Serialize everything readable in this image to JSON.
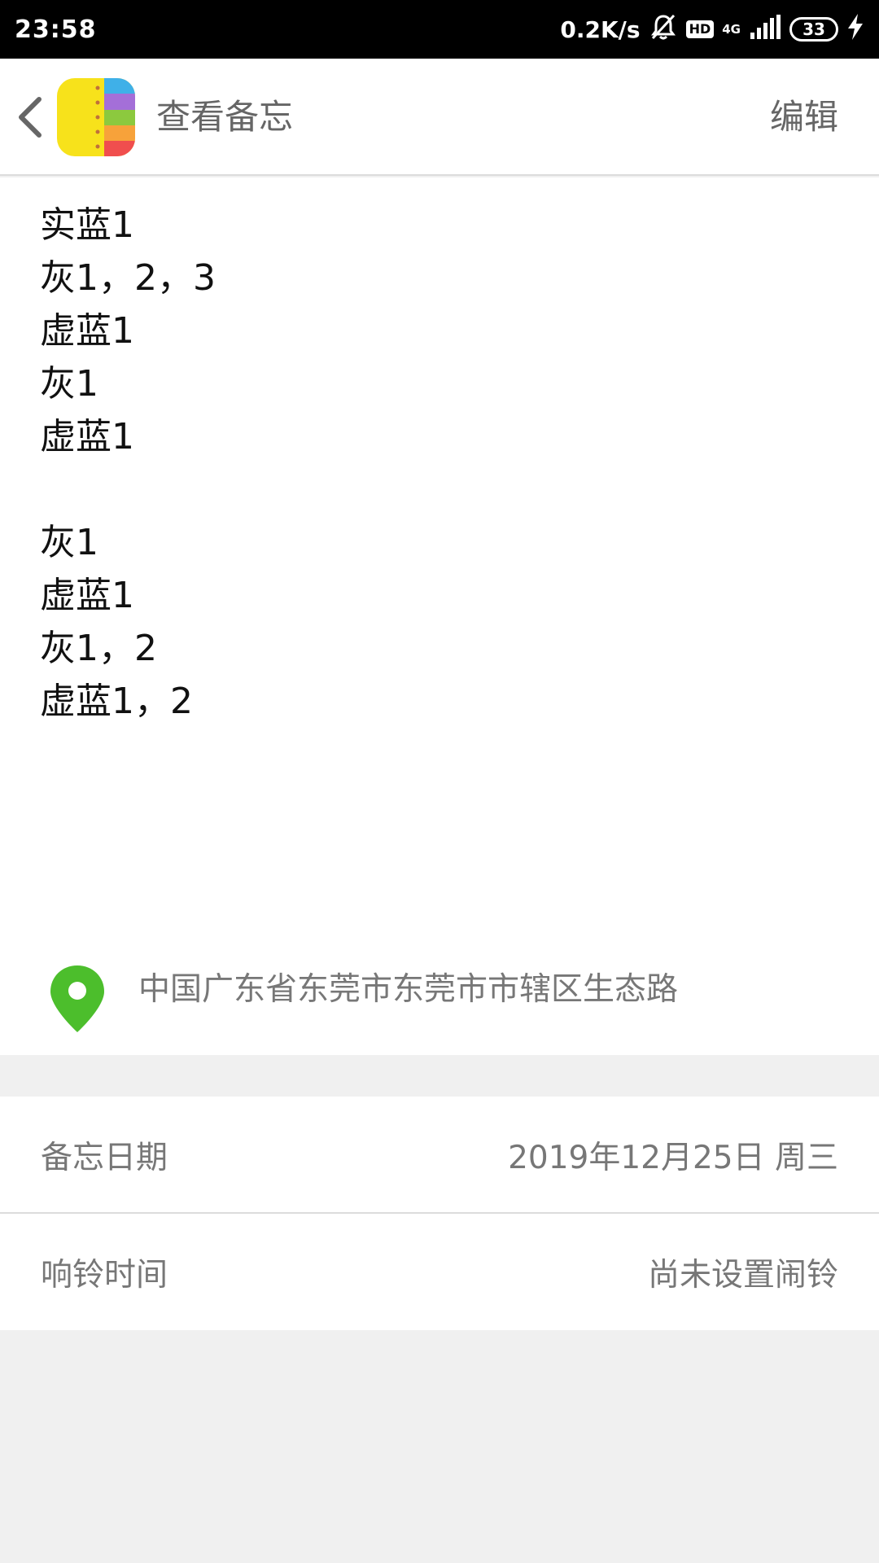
{
  "status_bar": {
    "time": "23:58",
    "net_speed": "0.2K/s",
    "hd_badge": "HD",
    "network": "4G",
    "battery": "33"
  },
  "header": {
    "title": "查看备忘",
    "edit_label": "编辑"
  },
  "note": {
    "lines": [
      "实蓝1",
      "灰1，2，3",
      "虚蓝1",
      "灰1",
      "虚蓝1",
      "",
      "灰1",
      "虚蓝1",
      "灰1，2",
      "虚蓝1，2"
    ]
  },
  "location": {
    "address": "中国广东省东莞市东莞市市辖区生态路"
  },
  "details": {
    "date_label": "备忘日期",
    "date_value": "2019年12月25日 周三",
    "alarm_label": "响铃时间",
    "alarm_value": "尚未设置闹铃"
  },
  "colors": {
    "pin_green": "#4cbe2c",
    "background_gray": "#f0f0f0"
  }
}
